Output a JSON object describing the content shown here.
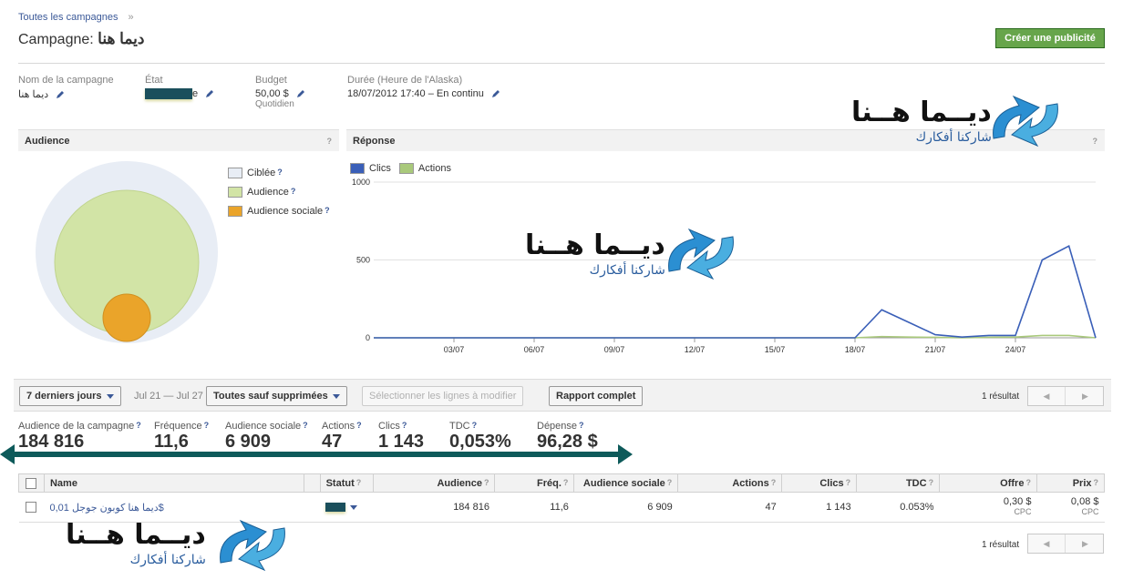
{
  "breadcrumb": {
    "link": "Toutes les campagnes",
    "sep": "»"
  },
  "title": {
    "prefix": "Campagne:",
    "name": "ديما هنا"
  },
  "create_ad_button": "Créer une publicité",
  "fields": {
    "name_label": "Nom de la campagne",
    "name_value": "ديما هنا",
    "state_label": "État",
    "state_value_suffix": "e",
    "budget_label": "Budget",
    "budget_value": "50,00 $",
    "budget_sub": "Quotidien",
    "duration_label": "Durée (Heure de l'Alaska)",
    "duration_value": "18/07/2012 17:40 – En continu"
  },
  "audience_panel": {
    "title": "Audience",
    "help": "?",
    "legend": [
      {
        "label": "Ciblée",
        "color": "#e8edf5"
      },
      {
        "label": "Audience",
        "color": "#d2e4a6"
      },
      {
        "label": "Audience sociale",
        "color": "#eaa42a"
      }
    ],
    "help_mark": "?"
  },
  "response_panel": {
    "title": "Réponse",
    "help": "?",
    "legend": [
      {
        "label": "Clics",
        "color": "#3a5fb8"
      },
      {
        "label": "Actions",
        "color": "#a9c97b"
      }
    ]
  },
  "chart_data": {
    "type": "line",
    "y_ticks": [
      "1000",
      "500",
      "0"
    ],
    "ylim": [
      0,
      1000
    ],
    "x_ticks": [
      "03/07",
      "06/07",
      "09/07",
      "12/07",
      "15/07",
      "18/07",
      "21/07",
      "24/07"
    ],
    "series": [
      {
        "name": "Clics",
        "color": "#3a5fb8",
        "x": [
          0,
          18,
          19,
          20,
          21,
          22,
          23,
          24,
          25,
          26,
          27
        ],
        "values": [
          0,
          0,
          180,
          100,
          20,
          5,
          15,
          15,
          500,
          590,
          0
        ]
      },
      {
        "name": "Actions",
        "color": "#a9c97b",
        "x": [
          0,
          18,
          19,
          20,
          21,
          22,
          23,
          24,
          25,
          26,
          27
        ],
        "values": [
          0,
          0,
          8,
          5,
          3,
          0,
          3,
          5,
          15,
          15,
          0
        ]
      }
    ]
  },
  "toolbar": {
    "range_button": "7 derniers jours",
    "range_dates": "Jul 21 — Jul 27",
    "filter_button": "Toutes sauf supprimées",
    "select_button": "Sélectionner les lignes à modifier",
    "report_button": "Rapport complet",
    "result_count": "1 résultat",
    "prev": "◀",
    "next": "▶"
  },
  "stats": [
    {
      "label": "Audience de la campagne",
      "value": "184 816"
    },
    {
      "label": "Fréquence",
      "value": "11,6"
    },
    {
      "label": "Audience sociale",
      "value": "6 909"
    },
    {
      "label": "Actions",
      "value": "47"
    },
    {
      "label": "Clics",
      "value": "1 143"
    },
    {
      "label": "TDC",
      "value": "0,053%"
    },
    {
      "label": "Dépense",
      "value": "96,28 $"
    }
  ],
  "table": {
    "headers": {
      "name": "Name",
      "status": "Statut",
      "audience": "Audience",
      "freq": "Fréq.",
      "social": "Audience sociale",
      "actions": "Actions",
      "clicks": "Clics",
      "ctr": "TDC",
      "bid": "Offre",
      "price": "Prix"
    },
    "row": {
      "name": "ديما هنا كوبون جوجل 0,01$",
      "audience": "184 816",
      "freq": "11,6",
      "social": "6 909",
      "actions": "47",
      "clicks": "1 143",
      "ctr": "0.053%",
      "bid": "0,30 $",
      "bid_sub": "CPC",
      "price": "0,08 $",
      "price_sub": "CPC"
    }
  },
  "bottom_pager": {
    "result_count": "1 résultat",
    "prev": "◀",
    "next": "▶"
  },
  "watermark": {
    "big": "ديــما هــنا",
    "small": "شاركنا أفكارك"
  }
}
